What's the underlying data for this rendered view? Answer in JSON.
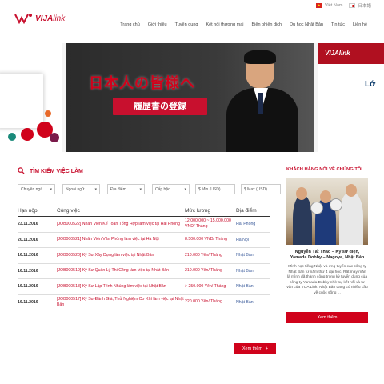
{
  "lang": [
    {
      "label": "Việt Nam",
      "flag": "vn"
    },
    {
      "label": "日本語",
      "flag": "jp"
    }
  ],
  "logo": {
    "mark": "V",
    "name": "VIJA",
    "suffix": "link"
  },
  "nav": [
    "Trang chủ",
    "Giới thiệu",
    "Tuyển dụng",
    "Kết nối thương mại",
    "Biên phiên dịch",
    "Du học Nhật Bản",
    "Tin tức",
    "Liên hệ"
  ],
  "banner": {
    "jp_title": "日本人の皆様へ",
    "jp_button": "履歴書の登録",
    "right_logo": "VIJAlink",
    "right_text": "Lớ"
  },
  "search": {
    "title": "TÌM KIẾM VIỆC LÀM",
    "filters": [
      "Chuyên ngà...",
      "Ngoại ngữ",
      "Địa điểm",
      "Cấp bậc",
      "$ Min (USD)",
      "$ Max (USD)"
    ]
  },
  "table": {
    "headers": {
      "date": "Hạn nộp",
      "job": "Công việc",
      "salary": "Mức lương",
      "location": "Địa điểm"
    },
    "rows": [
      {
        "date": "23.11.2016",
        "job": "[JOB000522] Nhân Viên Kế Toán Tổng Hợp làm việc tại Hải Phòng",
        "salary": "12.000.000 ~ 15.000.000 VND/ Tháng",
        "location": "Hải Phòng"
      },
      {
        "date": "20.11.2016",
        "job": "[JOB000521] Nhân Viên Văn Phòng làm việc tại Hà Nội",
        "salary": "8.500.000 VND/ Tháng",
        "location": "Hà Nội"
      },
      {
        "date": "16.11.2016",
        "job": "[JOB000520] Kỹ Sư Xây Dựng làm việc tại Nhật Bản",
        "salary": "210.000 Yên/ Tháng",
        "location": "Nhật Bản"
      },
      {
        "date": "16.11.2016",
        "job": "[JOB000519] Kỹ Sư Quản Lý Thi Công làm việc tại Nhật Bản",
        "salary": "210.000 Yên/ Tháng",
        "location": "Nhật Bản"
      },
      {
        "date": "16.11.2016",
        "job": "[JOB000518] Kỹ Sư Lập Trình Nhúng làm việc tại Nhật Bản",
        "salary": "> 250.000 Yên/ Tháng",
        "location": "Nhật Bản"
      },
      {
        "date": "16.11.2016",
        "job": "[JOB000517] Kỹ Sư Đánh Giá, Thử Nghiệm Cơ Khí làm việc tại Nhật Bản",
        "salary": "220.000 Yên/ Tháng",
        "location": "Nhật Bản"
      }
    ],
    "more_label": "Xem thêm"
  },
  "testimonial": {
    "title": "KHÁCH HÀNG NÓI VỀ CHÚNG TÔI",
    "name": "Nguyễn Tất Thảo – Kỹ sư điện, Yamada Dobby – Nagoya, Nhật Bản",
    "text": "Mình học tiếng Nhật và ứng tuyển các công ty Nhật Bản từ năm thứ 4 đại học. Rất may mắn là mình đã thành công trong kỳ tuyển dụng của công ty Yamada Dobby nhờ sự kết nối và tư vấn của VIJA Link. Nhật Bản đang có nhiều cầu về cuộc sống ...",
    "button": "Xem thêm"
  },
  "colors": {
    "accent": "#c8102e",
    "button": "#d0021b",
    "link": "#3a5a9a"
  }
}
